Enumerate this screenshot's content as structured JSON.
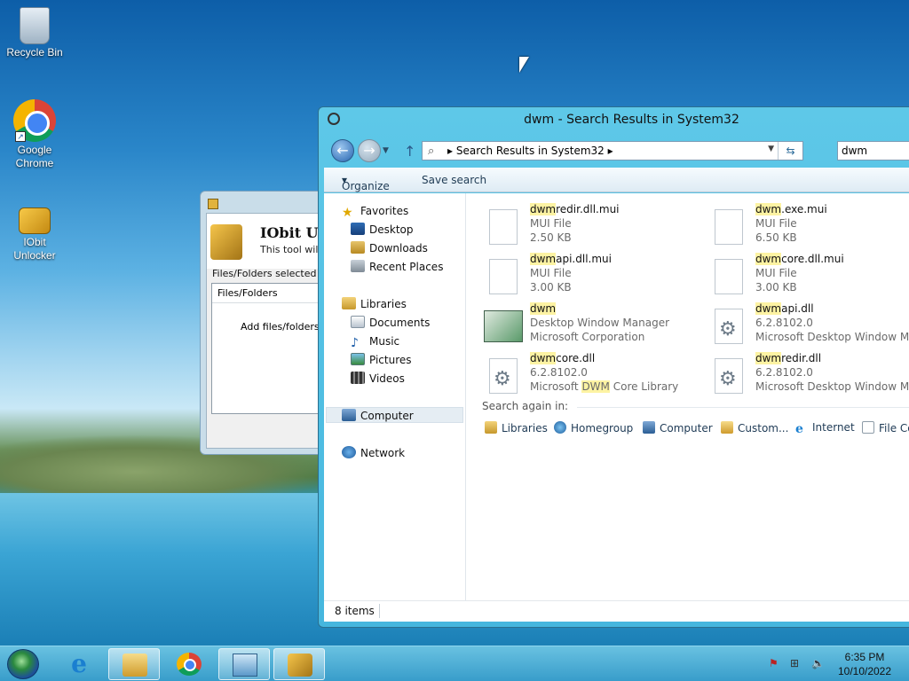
{
  "desktop": {
    "icons": [
      {
        "label": "Recycle Bin"
      },
      {
        "label": "Google Chrome"
      },
      {
        "label": "IObit Unlocker"
      }
    ]
  },
  "iobit": {
    "title": "IObit Un",
    "description": "This tool will h",
    "selected_label": "Files/Folders selected",
    "column_header": "Files/Folders",
    "empty_text": "Add files/folders to"
  },
  "explorer": {
    "title": "dwm - Search Results in System32",
    "address_path": "Search Results in System32",
    "search_value": "dwm",
    "toolbar": {
      "organize": "Organize",
      "save_search": "Save search"
    },
    "nav": {
      "favorites": "Favorites",
      "desktop": "Desktop",
      "downloads": "Downloads",
      "recent_places": "Recent Places",
      "libraries": "Libraries",
      "documents": "Documents",
      "music": "Music",
      "pictures": "Pictures",
      "videos": "Videos",
      "computer": "Computer",
      "network": "Network"
    },
    "results": [
      {
        "hl": "dwm",
        "rest": "redir.dll.mui",
        "l2": "MUI File",
        "l3": "2.50 KB"
      },
      {
        "hl": "dwm",
        "rest": ".exe.mui",
        "l2": "MUI File",
        "l3": "6.50 KB"
      },
      {
        "hl": "dwm",
        "rest": "api.dll.mui",
        "l2": "MUI File",
        "l3": "3.00 KB"
      },
      {
        "hl": "dwm",
        "rest": "core.dll.mui",
        "l2": "MUI File",
        "l3": "3.00 KB"
      },
      {
        "hl": "dwm",
        "rest": "",
        "l2": "Desktop Window Manager",
        "l3": "Microsoft Corporation"
      },
      {
        "hl": "dwm",
        "rest": "api.dll",
        "l2": "6.2.8102.0",
        "l3": "Microsoft Desktop Window Mana"
      },
      {
        "hl": "dwm",
        "rest": "core.dll",
        "l2": "6.2.8102.0",
        "l3_pre": "Microsoft ",
        "l3_hl": "DWM",
        "l3_post": " Core Library"
      },
      {
        "hl": "dwm",
        "rest": "redir.dll",
        "l2": "6.2.8102.0",
        "l3": "Microsoft Desktop Window Mana"
      }
    ],
    "search_again": {
      "label": "Search again in:",
      "items": [
        "Libraries",
        "Homegroup",
        "Computer",
        "Custom...",
        "Internet",
        "File Co"
      ]
    },
    "status": "8 items"
  },
  "taskbar": {
    "clock_time": "6:35 PM",
    "clock_date": "10/10/2022"
  }
}
